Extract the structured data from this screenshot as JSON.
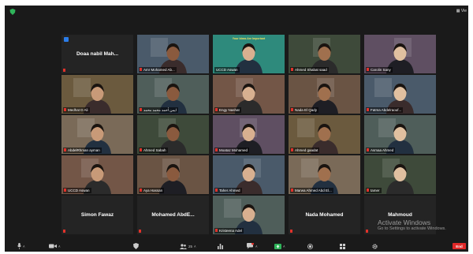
{
  "window": {
    "view_label": "Vie"
  },
  "participants": [
    {
      "name": "Doaa nabil Mah...",
      "display": "name",
      "hand_raised": true,
      "muted": true
    },
    {
      "name": "Amr Mohamed Ab...",
      "display": "video",
      "muted": true
    },
    {
      "name": "UCCD Aswan",
      "display": "video",
      "muted": false,
      "active_speaker": true,
      "banner": "Your Ideas Are Important"
    },
    {
      "name": "Ahmed Shabat saad",
      "display": "video",
      "muted": true
    },
    {
      "name": "Carolin Sany",
      "display": "video",
      "muted": true
    },
    {
      "name": "Medhat D Ali",
      "display": "video",
      "muted": true
    },
    {
      "name": "ايمن أحمد محمد محمد",
      "display": "video",
      "muted": true
    },
    {
      "name": "Engy Nashat",
      "display": "video",
      "muted": true
    },
    {
      "name": "Nada El Qady",
      "display": "video",
      "muted": true
    },
    {
      "name": "Fatma Abdelraouf...",
      "display": "video",
      "muted": true
    },
    {
      "name": "AbdelRhman ayman",
      "display": "video",
      "muted": true
    },
    {
      "name": "Ahmed Sabah",
      "display": "video",
      "muted": true
    },
    {
      "name": "Moataz Mohamed",
      "display": "video",
      "muted": true
    },
    {
      "name": "Ahmed gaadat",
      "display": "video",
      "muted": true
    },
    {
      "name": "Asmaa Ahmed",
      "display": "video",
      "muted": true
    },
    {
      "name": "UCCD Aswan",
      "display": "video",
      "muted": true
    },
    {
      "name": "Aya Hassan",
      "display": "video",
      "muted": true
    },
    {
      "name": "Taher Ahmed",
      "display": "video",
      "muted": true
    },
    {
      "name": "Marwa Ahmed Abd El...",
      "display": "video",
      "muted": true
    },
    {
      "name": "tamer",
      "display": "video",
      "muted": true
    },
    {
      "name": "Simon Fawaz",
      "display": "name",
      "muted": true
    },
    {
      "name": "Mohamed AbdE...",
      "display": "name",
      "muted": true
    },
    {
      "name": "Kristeena Adel",
      "display": "video",
      "muted": true
    },
    {
      "name": "Nada Mohamed",
      "display": "name",
      "muted": true
    },
    {
      "name": "Mahmoud",
      "display": "name",
      "muted": true
    }
  ],
  "toolbar": {
    "participants_count": "25",
    "end_label": "End"
  },
  "watermark": {
    "title": "Activate Windows",
    "subtitle": "Go to Settings to activate Windows."
  },
  "colors": {
    "background": "#1a1a1a",
    "tile": "#242424",
    "muted_red": "#e0322b",
    "active_speaker": "#d4c300",
    "end_button": "#e02828",
    "raise_hand": "#2b7de9"
  }
}
